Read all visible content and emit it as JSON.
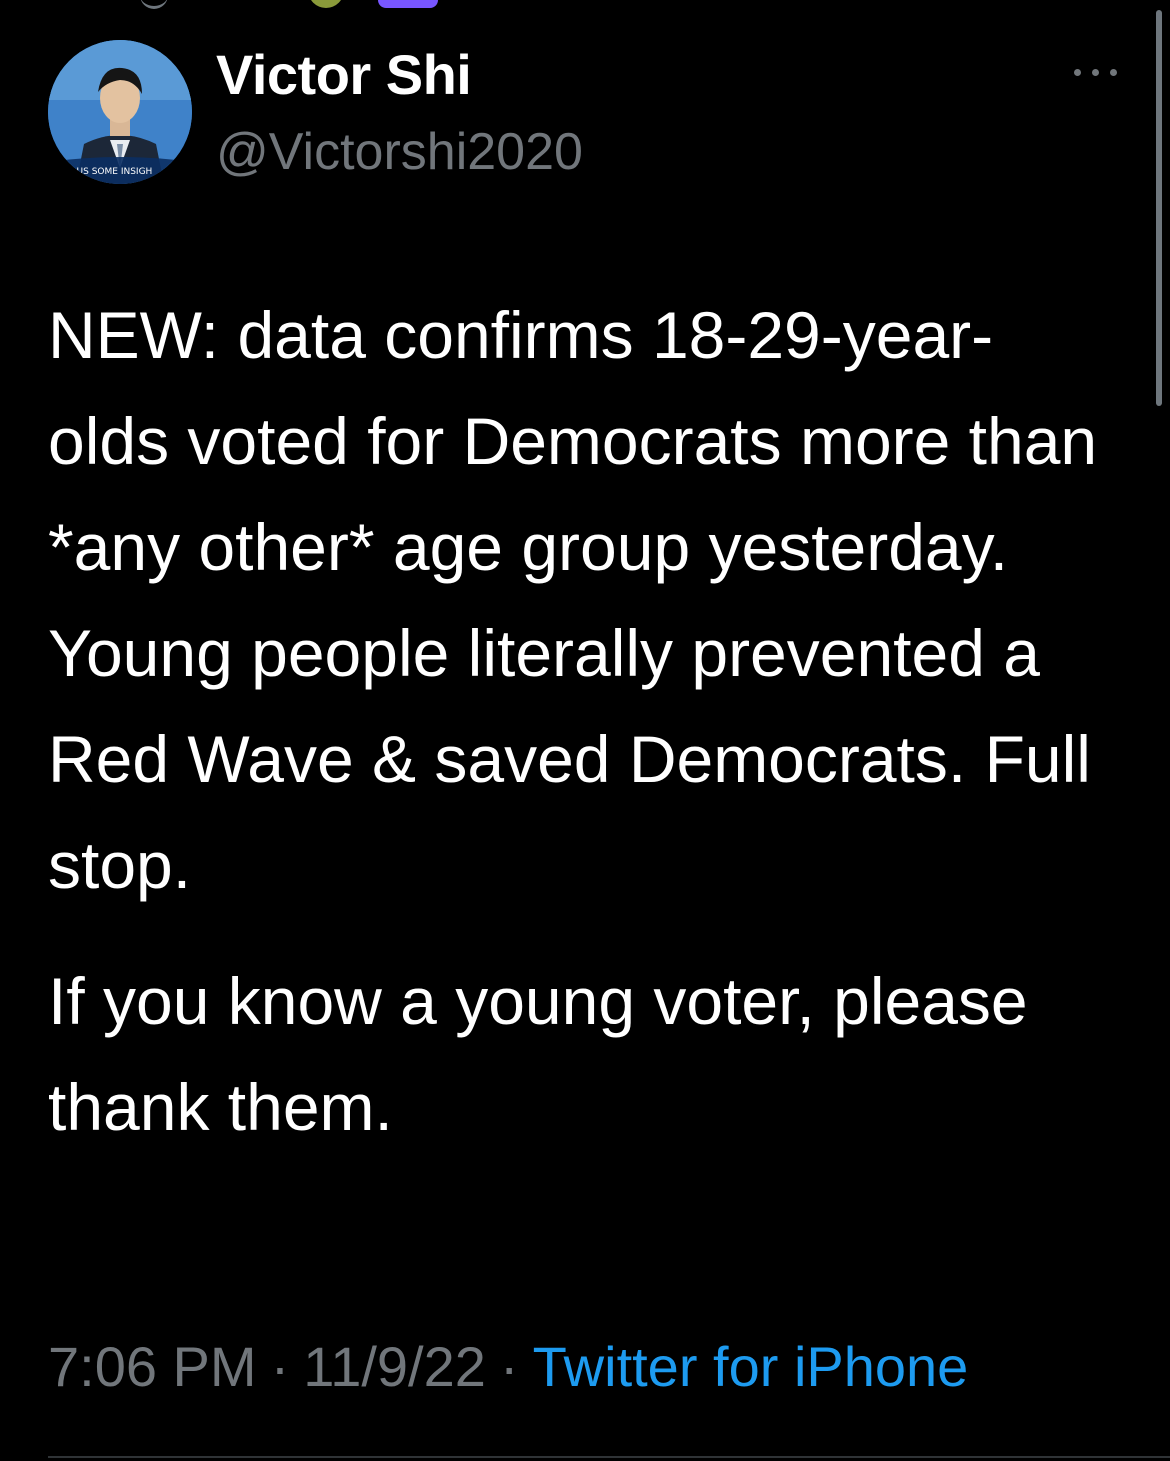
{
  "author": {
    "name": "Victor Shi",
    "handle": "@Victorshi2020",
    "avatar_icon": "profile-photo"
  },
  "tweet": {
    "paragraphs": [
      "NEW: data confirms 18-29-year-olds voted for Democrats more than *any other* age group yesterday. Young people literally prevented a Red Wave & saved Democrats. Full stop.",
      "If you know a young voter, please thank them."
    ]
  },
  "meta": {
    "time": "7:06 PM",
    "date": "11/9/22",
    "separator": "·",
    "source": "Twitter for iPhone"
  },
  "colors": {
    "background": "#000000",
    "text_primary": "#ffffff",
    "text_secondary": "#71767b",
    "link": "#1d9bf0"
  },
  "icons": {
    "more": "more-horizontal-icon"
  }
}
